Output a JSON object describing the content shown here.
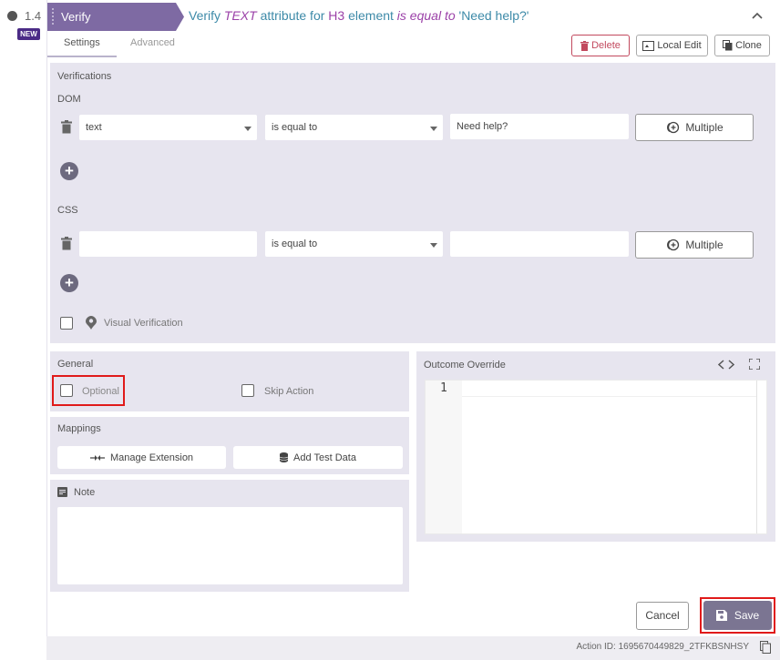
{
  "step": {
    "number": "1.4",
    "badge": "NEW",
    "type_label": "Verify"
  },
  "title": {
    "verb": "Verify",
    "attr": "TEXT",
    "mid": "attribute for",
    "tag": "H3",
    "el": "element",
    "op": "is equal to",
    "value": "'Need help?'"
  },
  "tabs": [
    {
      "label": "Settings",
      "active": true
    },
    {
      "label": "Advanced",
      "active": false
    }
  ],
  "toolbar": {
    "delete_label": "Delete",
    "local_edit_label": "Local Edit",
    "clone_label": "Clone"
  },
  "verifications": {
    "heading": "Verifications",
    "dom": {
      "label": "DOM",
      "attribute": "text",
      "operator": "is equal to",
      "value": "Need help?",
      "multiple_label": "Multiple"
    },
    "css": {
      "label": "CSS",
      "attribute": "",
      "operator": "is equal to",
      "value": "",
      "multiple_label": "Multiple"
    },
    "visual_label": "Visual Verification"
  },
  "general": {
    "heading": "General",
    "optional_label": "Optional",
    "skip_label": "Skip Action"
  },
  "mappings": {
    "heading": "Mappings",
    "manage_label": "Manage Extension",
    "test_data_label": "Add Test Data"
  },
  "note": {
    "heading": "Note"
  },
  "outcome": {
    "heading": "Outcome Override",
    "line_number": "1"
  },
  "footer": {
    "cancel_label": "Cancel",
    "save_label": "Save",
    "action_id": "Action ID: 1695670449829_2TFKBSNHSY"
  },
  "colors": {
    "accent": "#7e6aa3",
    "badge": "#4b2b86",
    "danger": "#c2495e",
    "highlight": "#e01a1a",
    "panel": "#e7e5ef"
  }
}
